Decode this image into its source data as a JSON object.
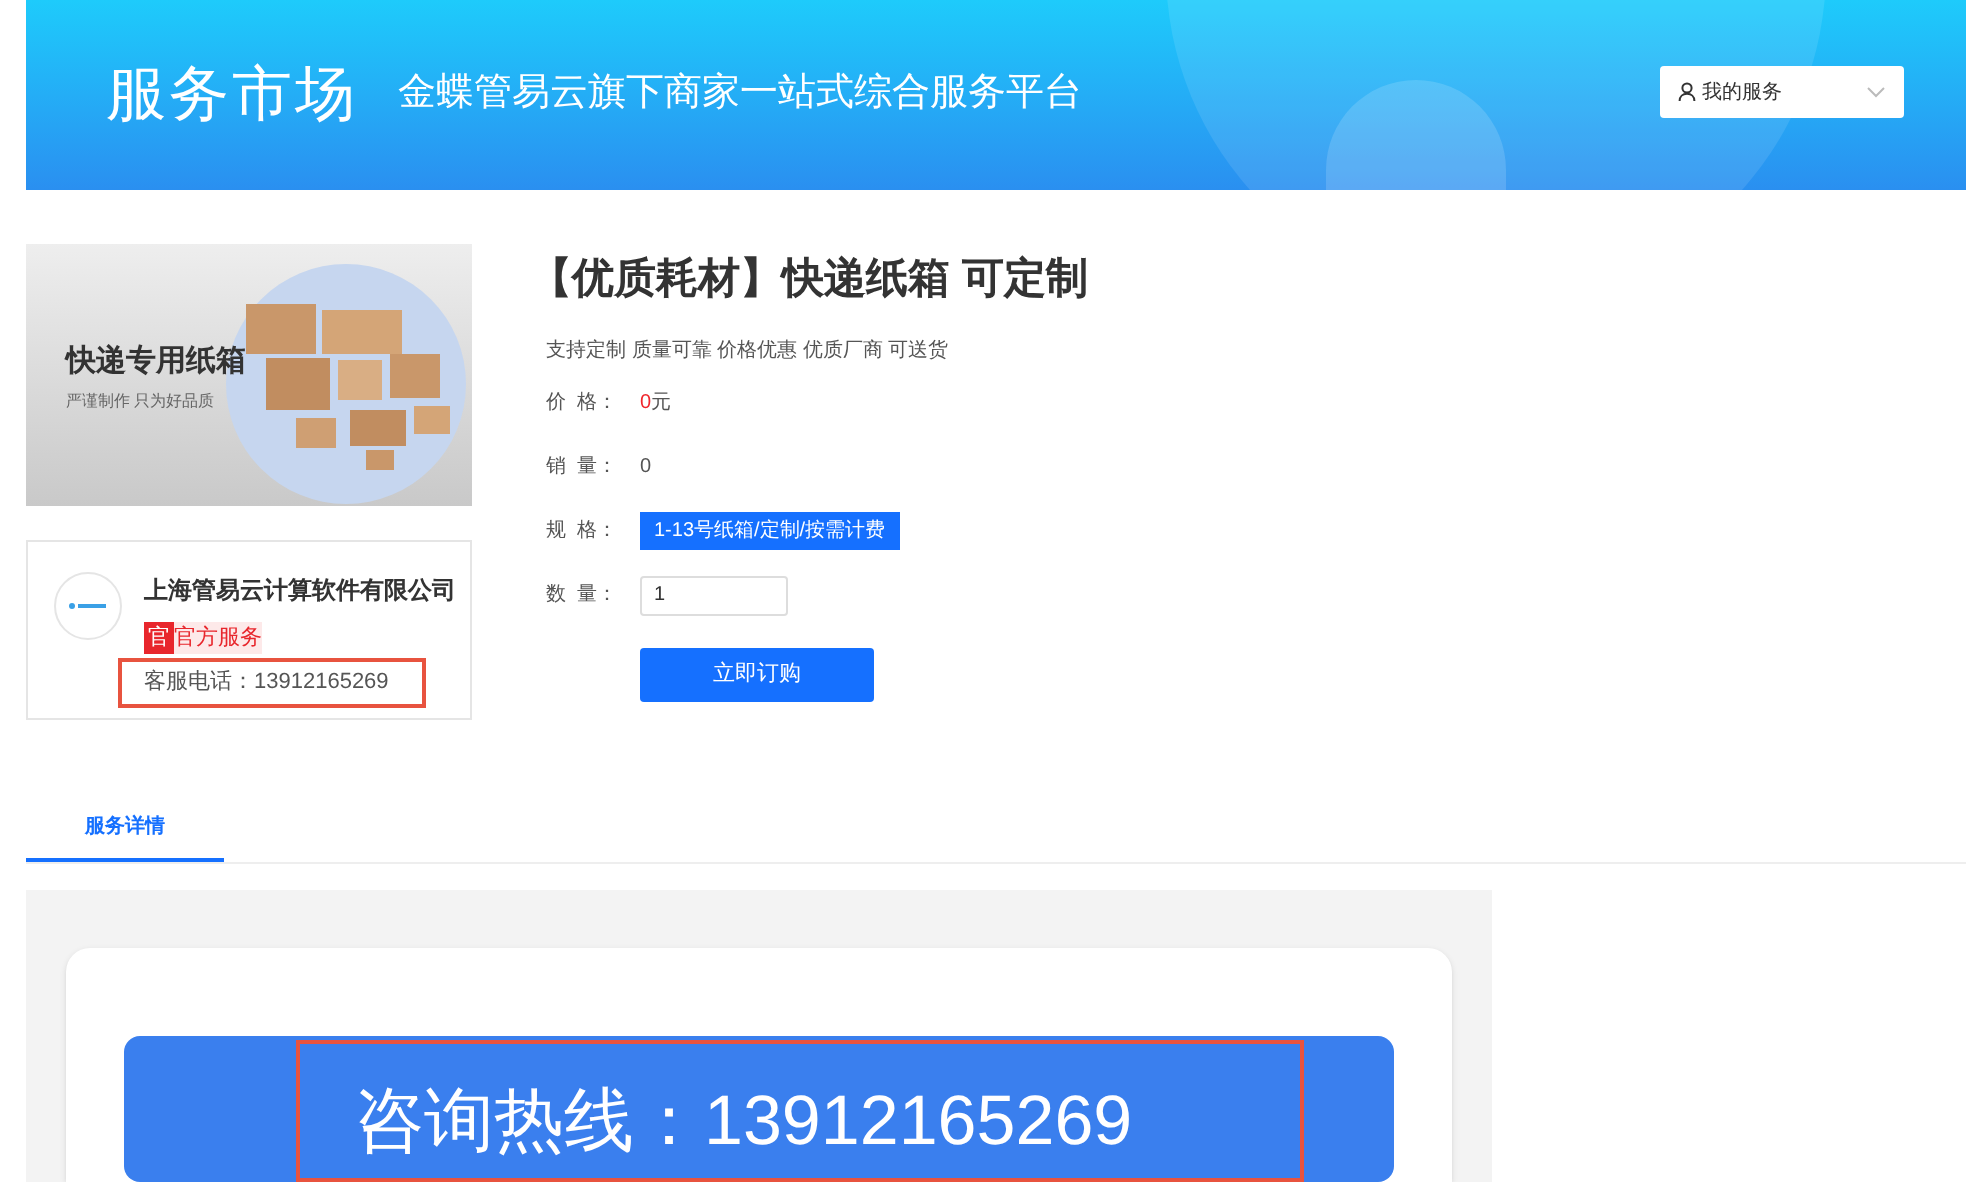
{
  "header": {
    "logo": "服务市场",
    "slogan": "金蝶管易云旗下商家一站式综合服务平台",
    "menu": {
      "label": "我的服务"
    }
  },
  "product_banner": {
    "title": "快递专用纸箱",
    "subtitle": "严谨制作 只为好品质"
  },
  "seller": {
    "name": "上海管易云计算软件有限公司",
    "badge": "官",
    "badge_text": "官方服务",
    "phone": "客服电话：13912165269"
  },
  "product": {
    "title": "【优质耗材】快递纸箱 可定制",
    "tags": "支持定制 质量可靠 价格优惠 优质厂商 可送货",
    "fields": [
      {
        "kind": "price",
        "label": "价  格：",
        "value": "0",
        "unit": "元"
      },
      {
        "kind": "text",
        "label": "销  量：",
        "value": "0"
      },
      {
        "kind": "option",
        "label": "规  格：",
        "value": "1-13号纸箱/定制/按需计费",
        "selected": true
      },
      {
        "kind": "input",
        "label": "数  量：",
        "value": "1"
      }
    ],
    "buy_button": "立即订购"
  },
  "tabs": [
    {
      "label": "服务详情",
      "selected": true
    }
  ],
  "detail": {
    "hotline": "咨询热线：13912165269"
  }
}
